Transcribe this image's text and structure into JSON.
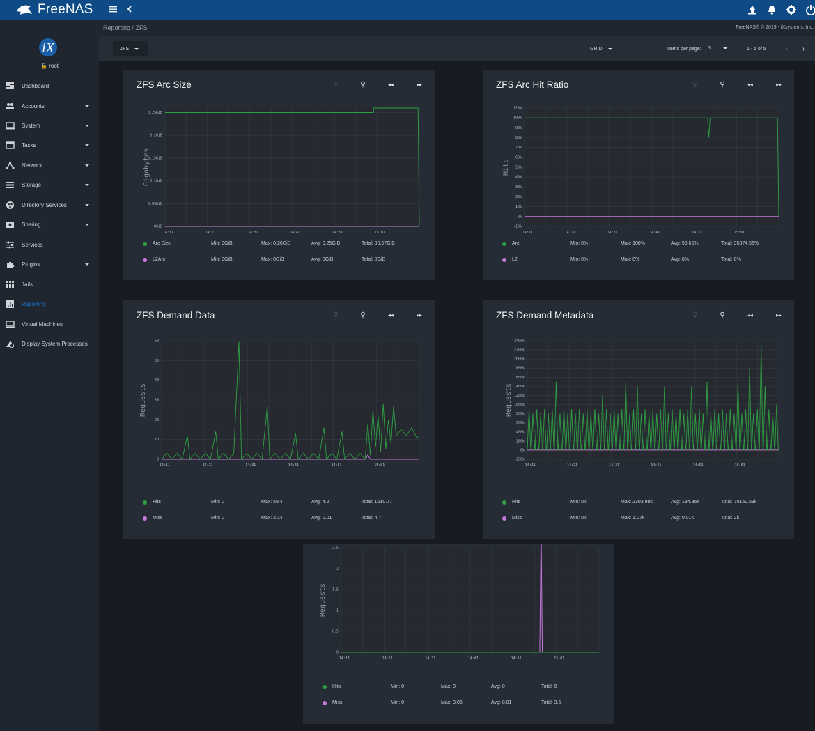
{
  "app": {
    "brand": "FreeNAS",
    "user": "root"
  },
  "colors": {
    "topbar": "#0e4b86",
    "sidebar": "#1f2630",
    "card": "#252c35",
    "hits": "#2ea043",
    "miss": "#c678dd",
    "active_nav": "#1a7ad0"
  },
  "topbar": {
    "icons": [
      "menu-icon",
      "chevron-left-icon",
      "upgrade-icon",
      "bell-icon",
      "gear-icon",
      "power-icon"
    ]
  },
  "sidebar": {
    "items": [
      {
        "label": "Dashboard",
        "icon": "dashboard-icon",
        "caret": false
      },
      {
        "label": "Accounts",
        "icon": "accounts-icon",
        "caret": true
      },
      {
        "label": "System",
        "icon": "system-icon",
        "caret": true
      },
      {
        "label": "Tasks",
        "icon": "tasks-icon",
        "caret": true
      },
      {
        "label": "Network",
        "icon": "network-icon",
        "caret": true
      },
      {
        "label": "Storage",
        "icon": "storage-icon",
        "caret": true
      },
      {
        "label": "Directory Services",
        "icon": "directory-services-icon",
        "caret": true
      },
      {
        "label": "Sharing",
        "icon": "sharing-icon",
        "caret": true
      },
      {
        "label": "Services",
        "icon": "services-icon",
        "caret": false
      },
      {
        "label": "Plugins",
        "icon": "plugins-icon",
        "caret": true
      },
      {
        "label": "Jails",
        "icon": "jails-icon",
        "caret": false
      },
      {
        "label": "Reporting",
        "icon": "reporting-icon",
        "caret": false,
        "active": true
      },
      {
        "label": "Virtual Machines",
        "icon": "virtual-machines-icon",
        "caret": false
      },
      {
        "label": "Display System Processes",
        "icon": "processes-icon",
        "caret": false
      }
    ]
  },
  "breadcrumb": {
    "path": "Reporting / ZFS",
    "copyright": "FreeNAS® © 2019 - iXsystems, Inc."
  },
  "toolbar": {
    "category": "ZFS",
    "layout": "GRID",
    "items_per_page_label": "Items per page:",
    "items_per_page": "5",
    "range": "1 - 5 of 5"
  },
  "cards": [
    {
      "title": "ZFS Arc Size",
      "ylabel": "Gigabytes",
      "yticks": [
        "0GiB",
        "0.05GiB",
        "0.1GiB",
        "0.15GiB",
        "0.2GiB",
        "0.25GiB"
      ],
      "xticks": [
        "14:11",
        "14:21",
        "14:31",
        "14:41",
        "14:51",
        "15:01"
      ],
      "legend": [
        {
          "name": "Arc Size",
          "min": "Min: 0GiB",
          "max": "Max: 0.26GiB",
          "avg": "Avg: 0.25GiB",
          "total": "Total: 90.57GiB"
        },
        {
          "name": "L2Arc",
          "min": "Min: 0GiB",
          "max": "Max: 0GiB",
          "avg": "Avg: 0GiB",
          "total": "Total: 0GiB"
        }
      ]
    },
    {
      "title": "ZFS Arc Hit Ratio",
      "ylabel": "Hits",
      "yticks": [
        "-10%",
        "0%",
        "10%",
        "20%",
        "30%",
        "40%",
        "50%",
        "60%",
        "70%",
        "80%",
        "90%",
        "100%",
        "110%"
      ],
      "xticks": [
        "14:11",
        "14:21",
        "14:31",
        "14:41",
        "14:51",
        "15:01"
      ],
      "legend": [
        {
          "name": "Arc",
          "min": "Min: 0%",
          "max": "Max: 100%",
          "avg": "Avg: 99.65%",
          "total": "Total: 35874.56%"
        },
        {
          "name": "L2",
          "min": "Min: 0%",
          "max": "Max: 0%",
          "avg": "Avg: 0%",
          "total": "Total: 0%"
        }
      ]
    },
    {
      "title": "ZFS Demand Data",
      "ylabel": "Requests",
      "yticks": [
        "0",
        "10",
        "20",
        "30",
        "40",
        "50",
        "60"
      ],
      "xticks": [
        "14:11",
        "14:21",
        "14:31",
        "14:41",
        "14:51",
        "15:01"
      ],
      "legend": [
        {
          "name": "Hits",
          "min": "Min: 0",
          "max": "Max: 59.4",
          "avg": "Avg: 4.2",
          "total": "Total: 1510.77"
        },
        {
          "name": "Miss",
          "min": "Min: 0",
          "max": "Max: 2.14",
          "avg": "Avg: 0.01",
          "total": "Total: 4.7"
        }
      ]
    },
    {
      "title": "ZFS Demand Metadata",
      "ylabel": "Requests",
      "yticks": [
        "-200k",
        "0k",
        "200k",
        "400k",
        "600k",
        "800k",
        "1000k",
        "1200k",
        "1400k",
        "1600k",
        "1800k",
        "2000k",
        "2200k",
        "2400k"
      ],
      "xticks": [
        "14:11",
        "14:21",
        "14:31",
        "14:41",
        "14:51",
        "15:01"
      ],
      "legend": [
        {
          "name": "Hits",
          "min": "Min: 0k",
          "max": "Max: 2303.98k",
          "avg": "Avg: 194.86k",
          "total": "Total: 70150.53k"
        },
        {
          "name": "Miss",
          "min": "Min: 0k",
          "max": "Max: 1.07k",
          "avg": "Avg: 0.01k",
          "total": "Total: 2k"
        }
      ]
    },
    {
      "title": "",
      "ylabel": "Requests",
      "yticks": [
        "0",
        "0.5",
        "1",
        "1.5",
        "2",
        "2.5"
      ],
      "xticks": [
        "14:11",
        "14:21",
        "14:31",
        "14:41",
        "14:51",
        "15:01"
      ],
      "legend": [
        {
          "name": "Hits",
          "min": "Min: 0",
          "max": "Max: 0",
          "avg": "Avg: 0",
          "total": "Total: 0"
        },
        {
          "name": "Miss",
          "min": "Min: 0",
          "max": "Max: 3.06",
          "avg": "Avg: 0.01",
          "total": "Total: 3.5"
        }
      ]
    }
  ],
  "chart_data": [
    {
      "type": "line",
      "title": "ZFS Arc Size",
      "ylabel": "Gigabytes",
      "ylim": [
        0,
        0.26
      ],
      "x": [
        "14:11",
        "14:21",
        "14:31",
        "14:41",
        "14:51",
        "15:01"
      ],
      "series": [
        {
          "name": "Arc Size",
          "points": [
            [
              0,
              0.25
            ],
            [
              0.82,
              0.25
            ],
            [
              0.82,
              0.26
            ],
            [
              0.995,
              0.26
            ],
            [
              1,
              0
            ]
          ]
        },
        {
          "name": "L2Arc",
          "points": [
            [
              0,
              0
            ],
            [
              1,
              0
            ]
          ]
        }
      ]
    },
    {
      "type": "line",
      "title": "ZFS Arc Hit Ratio",
      "ylabel": "Hits",
      "ylim": [
        -10,
        110
      ],
      "x": [
        "14:11",
        "14:21",
        "14:31",
        "14:41",
        "14:51",
        "15:01"
      ],
      "series": [
        {
          "name": "Arc",
          "points": [
            [
              0,
              100
            ],
            [
              0.72,
              100
            ],
            [
              0.725,
              80
            ],
            [
              0.73,
              100
            ],
            [
              0.995,
              100
            ],
            [
              1,
              0
            ]
          ]
        },
        {
          "name": "L2",
          "points": [
            [
              0,
              0
            ],
            [
              1,
              0
            ]
          ]
        }
      ]
    },
    {
      "type": "line",
      "title": "ZFS Demand Data",
      "ylabel": "Requests",
      "ylim": [
        0,
        60
      ],
      "x": [
        "14:11",
        "14:21",
        "14:31",
        "14:41",
        "14:51",
        "15:01"
      ],
      "series": [
        {
          "name": "Hits",
          "points": [
            [
              0,
              0
            ],
            [
              0.02,
              3
            ],
            [
              0.04,
              0
            ],
            [
              0.06,
              3
            ],
            [
              0.08,
              0
            ],
            [
              0.1,
              12
            ],
            [
              0.11,
              0
            ],
            [
              0.13,
              3
            ],
            [
              0.15,
              0
            ],
            [
              0.17,
              3
            ],
            [
              0.19,
              0
            ],
            [
              0.21,
              14
            ],
            [
              0.22,
              0
            ],
            [
              0.24,
              3
            ],
            [
              0.26,
              0
            ],
            [
              0.28,
              3
            ],
            [
              0.3,
              59.4
            ],
            [
              0.31,
              0
            ],
            [
              0.33,
              3
            ],
            [
              0.35,
              0
            ],
            [
              0.37,
              3
            ],
            [
              0.39,
              0
            ],
            [
              0.41,
              27
            ],
            [
              0.42,
              0
            ],
            [
              0.44,
              3
            ],
            [
              0.46,
              0
            ],
            [
              0.48,
              3
            ],
            [
              0.5,
              0
            ],
            [
              0.52,
              13
            ],
            [
              0.53,
              0
            ],
            [
              0.55,
              3
            ],
            [
              0.57,
              0
            ],
            [
              0.59,
              3
            ],
            [
              0.61,
              0
            ],
            [
              0.63,
              16
            ],
            [
              0.64,
              0
            ],
            [
              0.66,
              3
            ],
            [
              0.68,
              0
            ],
            [
              0.7,
              14
            ],
            [
              0.71,
              0
            ],
            [
              0.73,
              3
            ],
            [
              0.75,
              0
            ],
            [
              0.77,
              3
            ],
            [
              0.79,
              0
            ],
            [
              0.8,
              18
            ],
            [
              0.81,
              2
            ],
            [
              0.82,
              25
            ],
            [
              0.83,
              6
            ],
            [
              0.84,
              22
            ],
            [
              0.85,
              4
            ],
            [
              0.86,
              28
            ],
            [
              0.87,
              5
            ],
            [
              0.88,
              20
            ],
            [
              0.89,
              8
            ],
            [
              0.9,
              27
            ],
            [
              0.91,
              12
            ],
            [
              0.93,
              15
            ],
            [
              0.95,
              12
            ],
            [
              0.97,
              16
            ],
            [
              0.99,
              11
            ],
            [
              1,
              11
            ]
          ]
        },
        {
          "name": "Miss",
          "points": [
            [
              0,
              0
            ],
            [
              0.79,
              0
            ],
            [
              0.8,
              2.14
            ],
            [
              0.81,
              0
            ],
            [
              1,
              0
            ]
          ]
        }
      ]
    },
    {
      "type": "line",
      "title": "ZFS Demand Metadata",
      "ylabel": "Requests",
      "ylim": [
        -200,
        2400
      ],
      "x": [
        "14:11",
        "14:21",
        "14:31",
        "14:41",
        "14:51",
        "15:01"
      ],
      "series": [
        {
          "name": "Hits",
          "spike_values": [
            900,
            800,
            900,
            800,
            900,
            800,
            900,
            1500,
            800,
            900,
            800,
            900,
            800,
            900,
            800,
            900,
            800,
            900,
            800,
            1200,
            900,
            800,
            900,
            800,
            900,
            1500,
            800,
            900,
            1400,
            800,
            900,
            800,
            900,
            800,
            900,
            1400,
            800,
            900,
            800,
            900,
            800,
            900,
            1400,
            800,
            900,
            800,
            1500,
            800,
            900,
            800,
            900,
            800,
            900,
            800,
            1500,
            800,
            900,
            1800,
            800,
            900,
            2303.98,
            1400,
            900,
            800,
            1000
          ]
        },
        {
          "name": "Miss",
          "points": [
            [
              0,
              0
            ],
            [
              1,
              0
            ]
          ]
        }
      ]
    },
    {
      "type": "line",
      "title": "",
      "ylabel": "Requests",
      "ylim": [
        0,
        2.5
      ],
      "x": [
        "14:11",
        "14:21",
        "14:31",
        "14:41",
        "14:51",
        "15:01"
      ],
      "series": [
        {
          "name": "Hits",
          "points": [
            [
              0,
              0
            ],
            [
              1,
              0
            ]
          ]
        },
        {
          "name": "Miss",
          "points": [
            [
              0,
              0
            ],
            [
              0.77,
              0
            ],
            [
              0.775,
              3.06
            ],
            [
              0.78,
              0
            ],
            [
              1,
              0
            ]
          ]
        }
      ]
    }
  ]
}
